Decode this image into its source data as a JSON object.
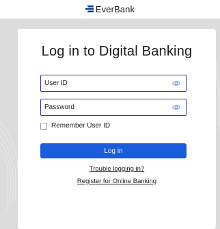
{
  "header": {
    "brand": "EverBank",
    "brand_color": "#0a3d91"
  },
  "login": {
    "title": "Log in to Digital Banking",
    "user_id_placeholder": "User ID",
    "password_placeholder": "Password",
    "remember_label": "Remember User ID",
    "remember_checked": false,
    "login_button": "Log in",
    "trouble_link": "Trouble logging in?",
    "register_link": "Register for Online Banking"
  },
  "icons": {
    "user_id_reveal": "eye-icon",
    "password_reveal": "eye-icon"
  },
  "colors": {
    "accent": "#1a5ddc",
    "field_border": "#3b3b8f",
    "eye_icon": "#5b8fe0"
  }
}
